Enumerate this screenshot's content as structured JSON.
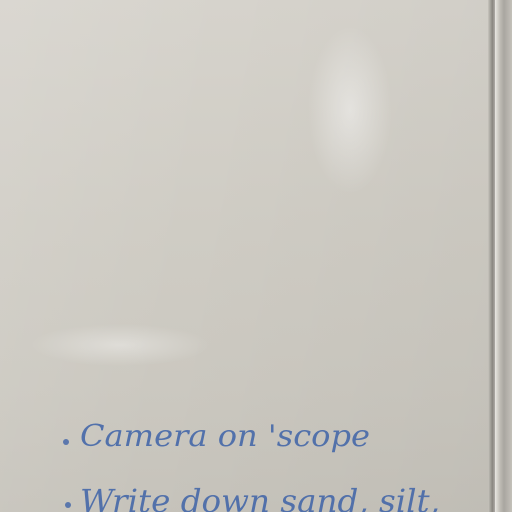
{
  "whiteboard": {
    "notes": [
      {
        "text": "Camera on 'scope"
      },
      {
        "text": "Write down sand, silt,"
      }
    ]
  },
  "colors": {
    "board": "#cfccc4",
    "marker_ink": "#3e63a8",
    "frame": "#a9a6a0"
  }
}
